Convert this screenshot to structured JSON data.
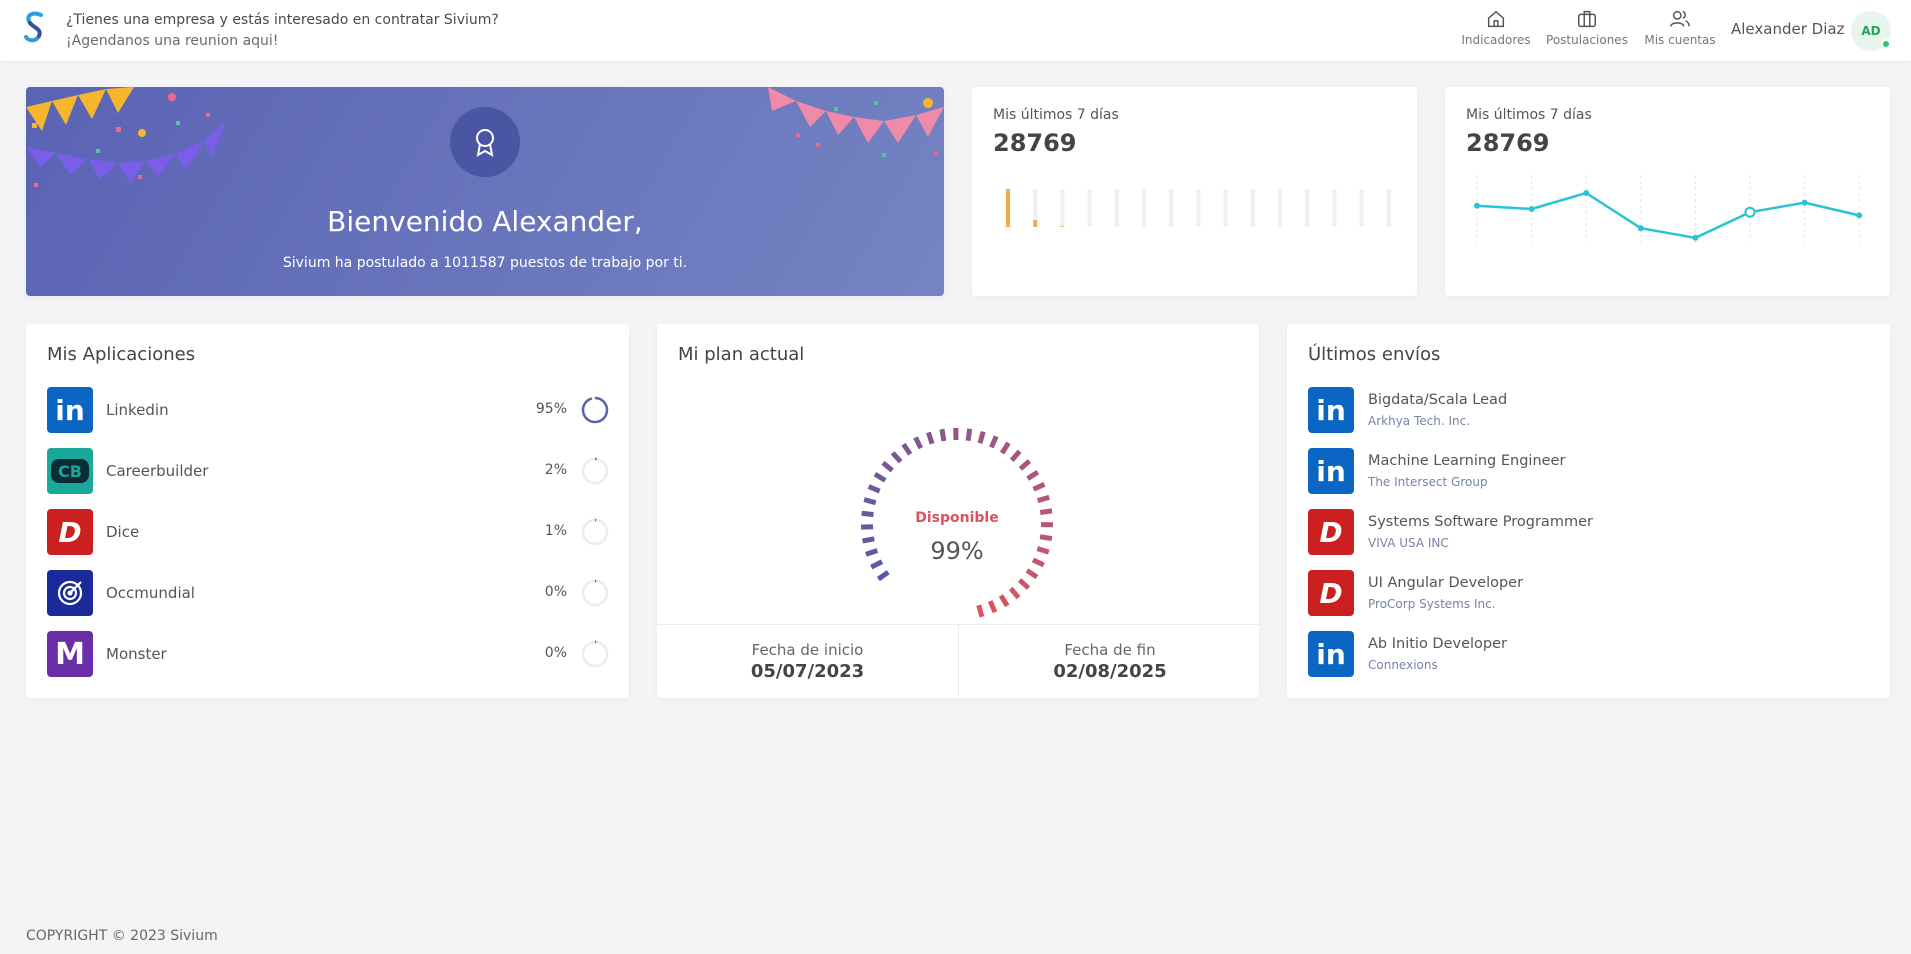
{
  "header": {
    "promo_line1": "¿Tienes una empresa y estás interesado en contratar Sivium?",
    "promo_line2": "¡Agendanos una reunion aqui!",
    "nav": [
      {
        "label": "Indicadores",
        "icon": "home-icon"
      },
      {
        "label": "Postulaciones",
        "icon": "briefcase-icon"
      },
      {
        "label": "Mis cuentas",
        "icon": "users-icon"
      }
    ],
    "username": "Alexander Diaz",
    "avatar_initials": "AD"
  },
  "hero": {
    "title": "Bienvenido Alexander,",
    "subtitle": "Sivium ha postulado a 1011587 puestos de trabajo por ti.",
    "icon": "award-icon"
  },
  "stats": [
    {
      "title": "Mis últimos 7 días",
      "value": "28769"
    },
    {
      "title": "Mis últimos 7 días",
      "value": "28769"
    }
  ],
  "applications": {
    "title": "Mis Aplicaciones",
    "items": [
      {
        "name": "Linkedin",
        "percent": "95%",
        "fraction": 0.95,
        "logo": "linkedin-logo",
        "color": "#0a66c2"
      },
      {
        "name": "Careerbuilder",
        "percent": "2%",
        "fraction": 0.02,
        "logo": "careerbuilder-logo",
        "color": "#19a89a"
      },
      {
        "name": "Dice",
        "percent": "1%",
        "fraction": 0.01,
        "logo": "dice-logo",
        "color": "#cc1f1f"
      },
      {
        "name": "Occmundial",
        "percent": "0%",
        "fraction": 0.0,
        "logo": "occmundial-logo",
        "color": "#1a2a9a"
      },
      {
        "name": "Monster",
        "percent": "0%",
        "fraction": 0.0,
        "logo": "monster-logo",
        "color": "#6a2ea8"
      }
    ]
  },
  "plan": {
    "title": "Mi plan actual",
    "gauge_label": "Disponible",
    "gauge_value": "99%",
    "gauge_fraction": 0.99,
    "start_label": "Fecha de inicio",
    "start_value": "05/07/2023",
    "end_label": "Fecha de fin",
    "end_value": "02/08/2025"
  },
  "sends": {
    "title": "Últimos envíos",
    "items": [
      {
        "title": "Bigdata/Scala Lead",
        "company": "Arkhya Tech. Inc.",
        "logo": "linkedin-logo"
      },
      {
        "title": "Machine Learning Engineer",
        "company": "The Intersect Group",
        "logo": "linkedin-logo"
      },
      {
        "title": "Systems Software Programmer",
        "company": "VIVA USA INC",
        "logo": "dice-logo"
      },
      {
        "title": "UI Angular Developer",
        "company": "ProCorp Systems Inc.",
        "logo": "dice-logo"
      },
      {
        "title": "Ab Initio Developer",
        "company": "Connexions",
        "logo": "linkedin-logo"
      }
    ]
  },
  "chart_data": [
    {
      "type": "bar",
      "categories": [
        "1",
        "2",
        "3",
        "4",
        "5",
        "6",
        "7",
        "8",
        "9",
        "10",
        "11",
        "12",
        "13",
        "14",
        "15"
      ],
      "values": [
        1.0,
        0.18,
        0.02,
        0,
        0,
        0,
        0,
        0,
        0,
        0,
        0,
        0,
        0,
        0,
        0
      ],
      "ylim": [
        0,
        1
      ]
    },
    {
      "type": "line",
      "x": [
        1,
        2,
        3,
        4,
        5,
        6,
        7,
        8
      ],
      "values": [
        0.55,
        0.5,
        0.75,
        0.2,
        0.05,
        0.45,
        0.6,
        0.4
      ],
      "ylim": [
        0,
        1
      ],
      "color": "#2ac3d6"
    }
  ],
  "footer": {
    "copyright": "COPYRIGHT © 2023 Sivium"
  }
}
